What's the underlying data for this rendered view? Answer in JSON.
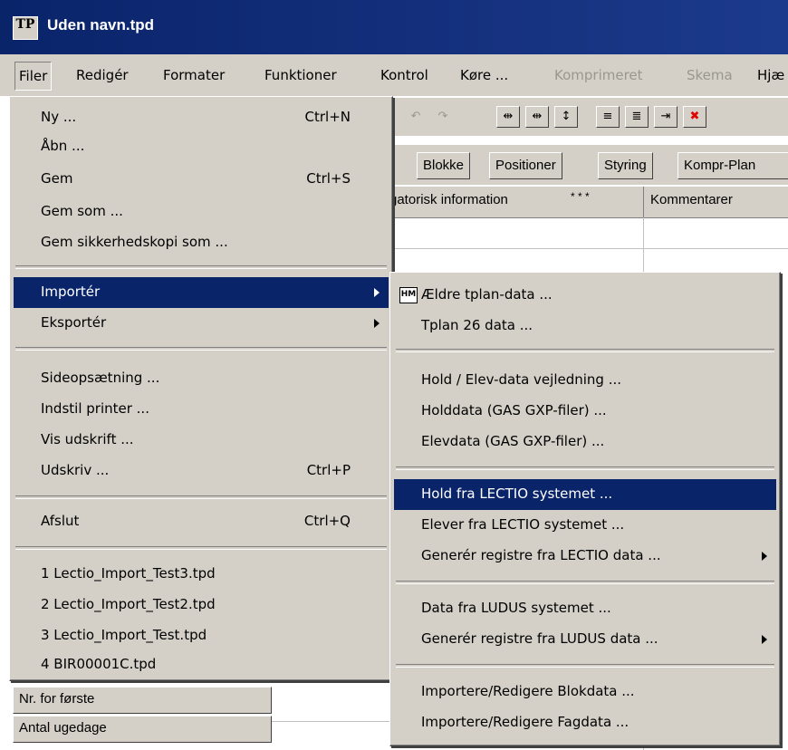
{
  "window": {
    "title": "Uden navn.tpd",
    "icon_text": "TP"
  },
  "menubar": {
    "items": [
      "Filer",
      "Redigér",
      "Formater",
      "Funktioner",
      "Kontrol",
      "Køre ...",
      "Komprimeret",
      "Skema",
      "Hjæ"
    ]
  },
  "tabs": [
    "Blokke",
    "Positioner",
    "Styring",
    "Kompr-Plan"
  ],
  "grid": {
    "headers": [
      "gatorisk information",
      "*  *  *",
      "Kommentarer"
    ]
  },
  "left_labels": [
    "Nr. for første",
    "Antal ugedage"
  ],
  "file_menu": {
    "items": [
      {
        "label": "Ny ...",
        "shortcut": "Ctrl+N"
      },
      {
        "label": "Åbn ...",
        "shortcut": ""
      },
      {
        "label": "Gem",
        "shortcut": "Ctrl+S"
      },
      {
        "label": "Gem som ...",
        "shortcut": ""
      },
      {
        "label": "Gem sikkerhedskopi som ...",
        "shortcut": ""
      },
      {
        "label": "Importér",
        "shortcut": ""
      },
      {
        "label": "Eksportér",
        "shortcut": ""
      },
      {
        "label": "Sideopsætning ...",
        "shortcut": ""
      },
      {
        "label": "Indstil printer ...",
        "shortcut": ""
      },
      {
        "label": "Vis udskrift ...",
        "shortcut": ""
      },
      {
        "label": "Udskriv ...",
        "shortcut": "Ctrl+P"
      },
      {
        "label": "Afslut",
        "shortcut": "Ctrl+Q"
      },
      {
        "label": "1 Lectio_Import_Test3.tpd",
        "shortcut": ""
      },
      {
        "label": "2 Lectio_Import_Test2.tpd",
        "shortcut": ""
      },
      {
        "label": "3 Lectio_Import_Test.tpd",
        "shortcut": ""
      },
      {
        "label": "4 BIR00001C.tpd",
        "shortcut": ""
      }
    ]
  },
  "import_submenu": {
    "items": [
      {
        "label": "Ældre tplan-data ..."
      },
      {
        "label": "Tplan 26 data ..."
      },
      {
        "label": "Hold / Elev-data vejledning ..."
      },
      {
        "label": "Holddata (GAS GXP-filer) ..."
      },
      {
        "label": "Elevdata (GAS GXP-filer) ..."
      },
      {
        "label": "Hold fra LECTIO systemet ..."
      },
      {
        "label": "Elever fra LECTIO systemet ..."
      },
      {
        "label": "Generér registre fra LECTIO data ..."
      },
      {
        "label": "Data fra LUDUS systemet ..."
      },
      {
        "label": "Generér registre fra LUDUS data ..."
      },
      {
        "label": "Importere/Redigere Blokdata ..."
      },
      {
        "label": "Importere/Redigere Fagdata ..."
      }
    ]
  },
  "colors": {
    "highlight": "#0a246a",
    "face": "#d4d0c8",
    "titlebar": "#0a246a",
    "delete_icon": "#e00000"
  }
}
